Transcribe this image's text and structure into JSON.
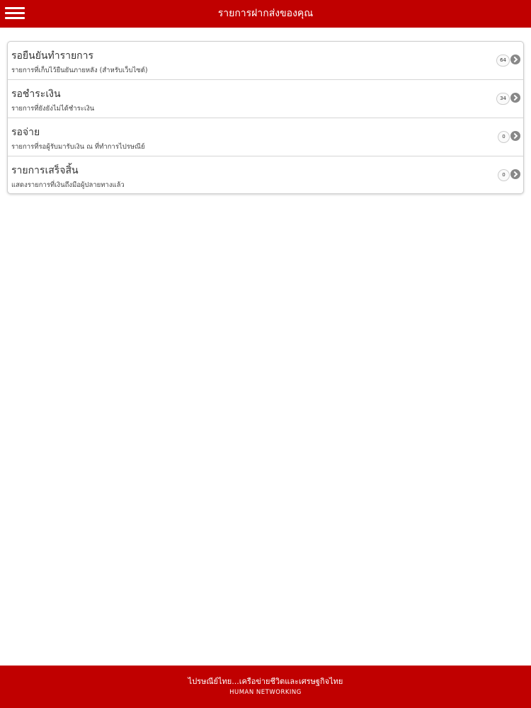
{
  "header": {
    "title": "รายการฝากส่งของคุณ",
    "menu_icon": "hamburger-menu-icon",
    "background_color": "#c00000"
  },
  "items": [
    {
      "title": "รอยืนยันทำรายการ",
      "subtitle": "รายการที่เก็บไว้ยืนยันภายหลัง (สำหรับเว็บไซต์)",
      "count": "64",
      "icon": "chevron-right-circle-icon"
    },
    {
      "title": "รอชำระเงิน",
      "subtitle": "รายการที่ยังยังไม่ได้ชำระเงิน",
      "count": "34",
      "icon": "chevron-right-circle-icon"
    },
    {
      "title": "รอจ่าย",
      "subtitle": "รายการที่รอผู้รับมารับเงิน ณ ที่ทำการไปรษณีย์",
      "count": "0",
      "icon": "chevron-right-circle-icon"
    },
    {
      "title": "รายการเสร็จสิ้น",
      "subtitle": "แสดงรายการที่เงินถึงมือผู้ปลายทางแล้ว",
      "count": "0",
      "icon": "chevron-right-circle-icon"
    }
  ],
  "footer": {
    "tagline": "ไปรษณีย์ไทย...เครือข่ายชีวิตและเศรษฐกิจไทย",
    "slogan": "HUMAN NETWORKING",
    "background_color": "#c00000"
  }
}
